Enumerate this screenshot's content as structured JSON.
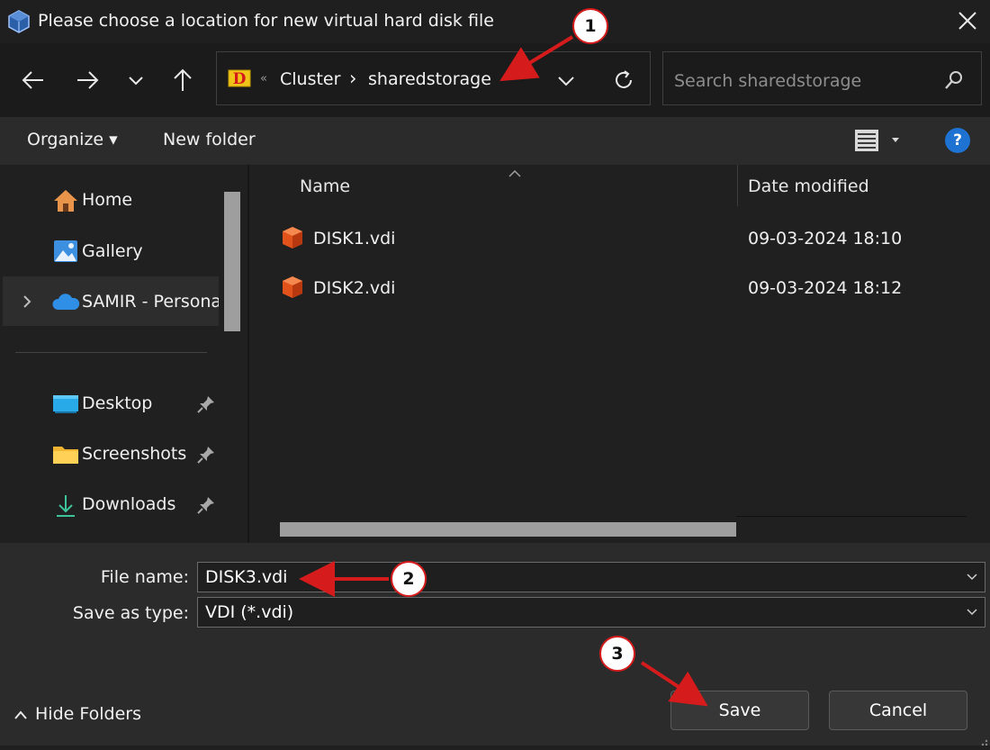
{
  "window": {
    "title": "Please choose a location for new virtual hard disk file"
  },
  "address": {
    "overflow": "«",
    "crumbs": [
      "Cluster",
      "sharedstorage"
    ],
    "separator": "›",
    "drive_letter": "D"
  },
  "search": {
    "placeholder": "Search sharedstorage"
  },
  "toolbar": {
    "organize_label": "Organize ▾",
    "new_folder_label": "New folder",
    "help_label": "?"
  },
  "sidebar": {
    "items": [
      {
        "label": "Home",
        "icon": "home-icon"
      },
      {
        "label": "Gallery",
        "icon": "gallery-icon"
      },
      {
        "label": "SAMIR - Persona",
        "icon": "onedrive-icon"
      },
      {
        "label": "Desktop",
        "icon": "desktop-icon"
      },
      {
        "label": "Screenshots",
        "icon": "folder-icon"
      },
      {
        "label": "Downloads",
        "icon": "downloads-icon"
      }
    ]
  },
  "file_list": {
    "columns": [
      "Name",
      "Date modified"
    ],
    "rows": [
      {
        "name": "DISK1.vdi",
        "modified": "09-03-2024 18:10"
      },
      {
        "name": "DISK2.vdi",
        "modified": "09-03-2024 18:12"
      }
    ]
  },
  "form": {
    "file_name_label": "File name:",
    "file_name_value": "DISK3.vdi",
    "save_type_label": "Save as type:",
    "save_type_value": "VDI (*.vdi)"
  },
  "footer": {
    "hide_folders_label": "Hide Folders",
    "save_label": "Save",
    "cancel_label": "Cancel"
  },
  "annotations": {
    "markers": [
      "1",
      "2",
      "3"
    ],
    "color": "#d51b1b"
  },
  "colors": {
    "accent": "#1e73d2",
    "file_icon": "#e2531c",
    "background": "#202020"
  }
}
